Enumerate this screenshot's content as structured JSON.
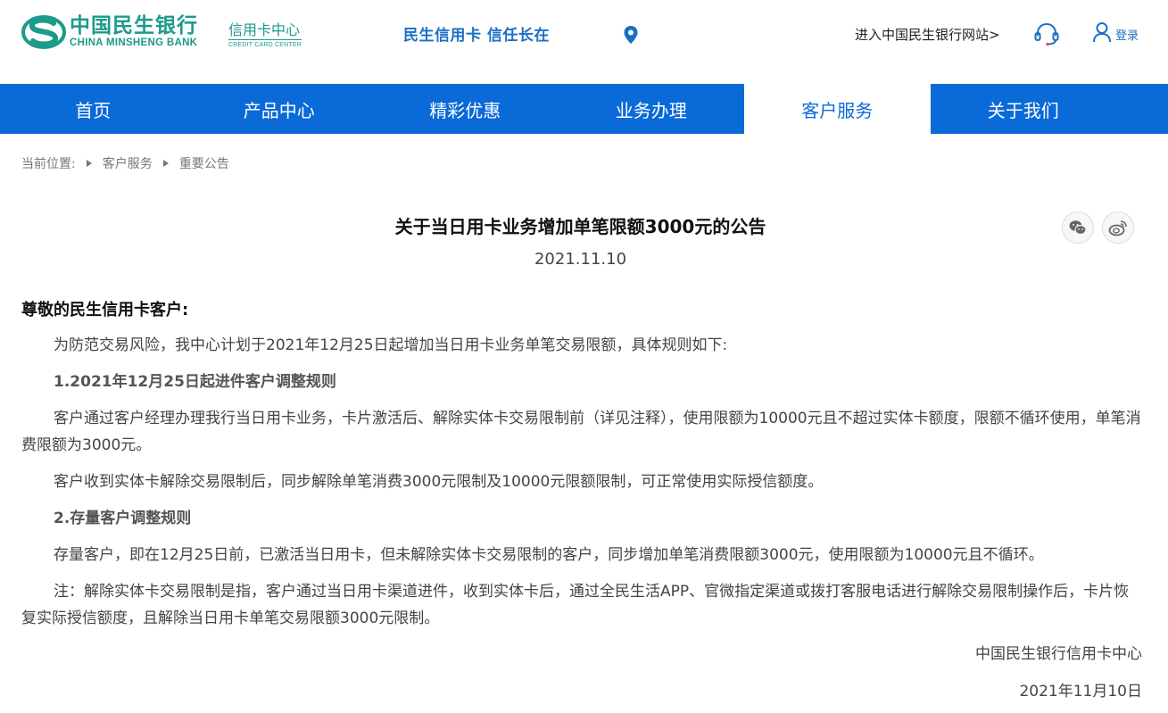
{
  "header": {
    "logo_cn": "中国民生银行",
    "logo_en": "CHINA MINSHENG BANK",
    "sub_cn": "信用卡中心",
    "sub_en": "CREDIT CARD CENTER",
    "slogan": "民生信用卡 信任长在",
    "site_link": "进入中国民生银行网站>",
    "login": "登录"
  },
  "nav": {
    "items": [
      {
        "label": "首页"
      },
      {
        "label": "产品中心"
      },
      {
        "label": "精彩优惠"
      },
      {
        "label": "业务办理"
      },
      {
        "label": "客户服务"
      },
      {
        "label": "关于我们"
      }
    ],
    "active": "客户服务"
  },
  "breadcrumb": {
    "prefix": "当前位置:",
    "items": [
      "客户服务",
      "重要公告"
    ]
  },
  "article": {
    "title": "关于当日用卡业务增加单笔限额3000元的公告",
    "date": "2021.11.10",
    "greeting": "尊敬的民生信用卡客户:",
    "paragraphs": [
      "为防范交易风险，我中心计划于2021年12月25日起增加当日用卡业务单笔交易限额，具体规则如下:",
      "1.2021年12月25日起进件客户调整规则",
      "客户通过客户经理办理我行当日用卡业务，卡片激活后、解除实体卡交易限制前（详见注释），使用限额为10000元且不超过实体卡额度，限额不循环使用，单笔消费限额为3000元。",
      "客户收到实体卡解除交易限制后，同步解除单笔消费3000元限制及10000元限额限制，可正常使用实际授信额度。",
      "2.存量客户调整规则",
      "存量客户，即在12月25日前，已激活当日用卡，但未解除实体卡交易限制的客户，同步增加单笔消费限额3000元，使用限额为10000元且不循环。",
      "注：解除实体卡交易限制是指，客户通过当日用卡渠道进件，收到实体卡后，通过全民生活APP、官微指定渠道或拨打客服电话进行解除交易限制操作后，卡片恢复实际授信额度，且解除当日用卡单笔交易限额3000元限制。"
    ],
    "signature": "中国民生银行信用卡中心",
    "sign_date": "2021年11月10日"
  },
  "colors": {
    "brand_green": "#1d9a8a",
    "nav_blue": "#0a6ad8"
  }
}
